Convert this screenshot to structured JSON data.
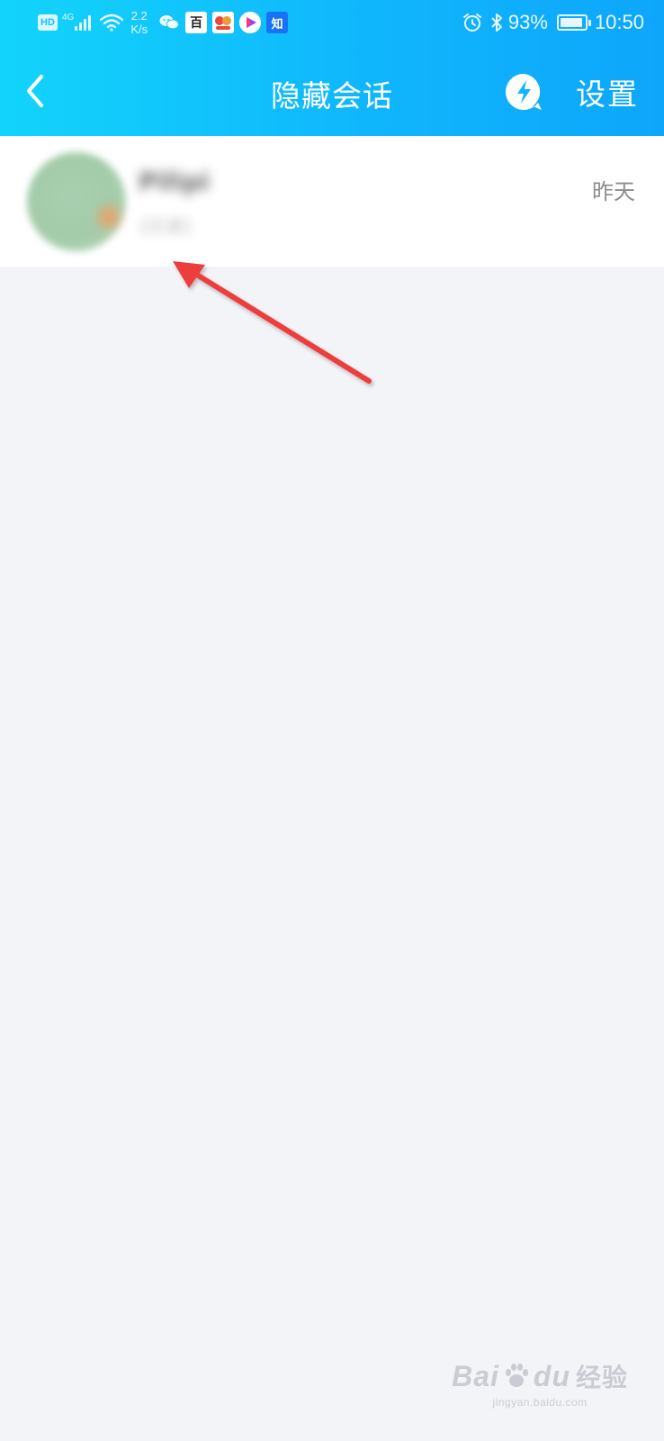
{
  "status_bar": {
    "hd": "HD",
    "network": "4G",
    "speed_value": "2.2",
    "speed_unit": "K/s",
    "baidu_icon_text": "百",
    "zhihu_icon_text": "知",
    "battery": "93%",
    "battery_level": 0.93,
    "time": "10:50"
  },
  "nav": {
    "title": "隐藏会话",
    "settings_label": "设置",
    "back_icon": "chevron-left-icon",
    "flash_icon": "lightning-bubble-icon"
  },
  "conversations": [
    {
      "name": "Pilipi",
      "preview": "[已读]",
      "time": "昨天"
    }
  ],
  "watermark": {
    "brand": "Bai",
    "brand_suffix": "du",
    "cn": "经验",
    "url": "jingyan.baidu.com"
  },
  "colors": {
    "header_start": "#12d4fb",
    "header_end": "#0ea6fb",
    "background": "#f3f4f8",
    "arrow": "#ee3d3d"
  }
}
